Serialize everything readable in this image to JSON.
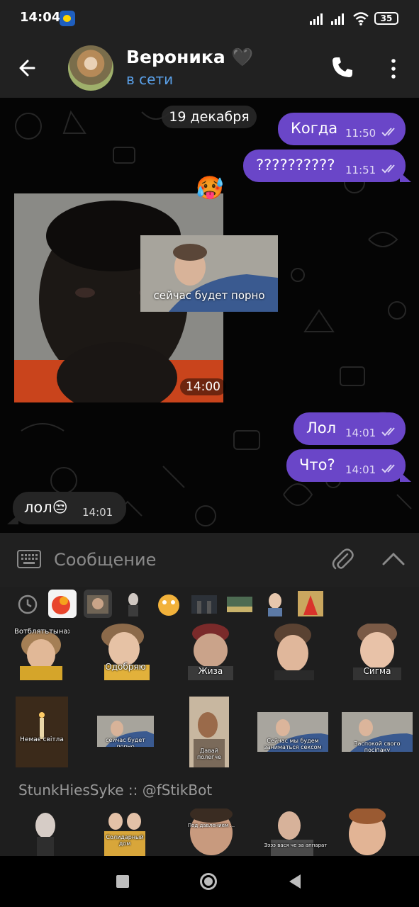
{
  "status_bar": {
    "time": "14:04",
    "battery": "35"
  },
  "header": {
    "contact_name": "Вероника 🖤",
    "contact_status": "в сети"
  },
  "chat": {
    "date_chip": "19 декабря",
    "messages": [
      {
        "direction": "outgoing",
        "text": "Когда",
        "time": "11:50"
      },
      {
        "direction": "outgoing",
        "text": "??????????",
        "time": "11:51"
      },
      {
        "direction": "incoming",
        "type": "photo",
        "time": "14:00",
        "reaction": "🥵",
        "sticker_caption": "сейчас будет порно"
      },
      {
        "direction": "outgoing",
        "text": "Лол",
        "time": "14:01"
      },
      {
        "direction": "outgoing",
        "text": "Что?",
        "time": "14:01"
      },
      {
        "direction": "incoming",
        "text": "лол😒",
        "time": "14:01"
      }
    ]
  },
  "input": {
    "placeholder": "Сообщение"
  },
  "stickers": {
    "row1_captions": [
      "Вотблятьтынахуй",
      "Одобряю",
      "Жиза",
      "",
      "Сигма"
    ],
    "row2_captions": [
      "Немає світла",
      "сейчас будет порно",
      "Давай полегче",
      "Сейчас мы будем заниматься сексом",
      "Заспокой свого посіпаку"
    ],
    "pack_title": "StunkHiesSyke :: @fStikBot",
    "row3_captions": [
      "",
      "Солидарный дом",
      "Под давлением ...",
      "Ээээ вася че за аппарат",
      ""
    ]
  },
  "colors": {
    "outgoing_bubble": "#6a46c8",
    "incoming_bubble": "#252525",
    "status_online": "#5aa0e8",
    "header_bg": "#212121"
  }
}
